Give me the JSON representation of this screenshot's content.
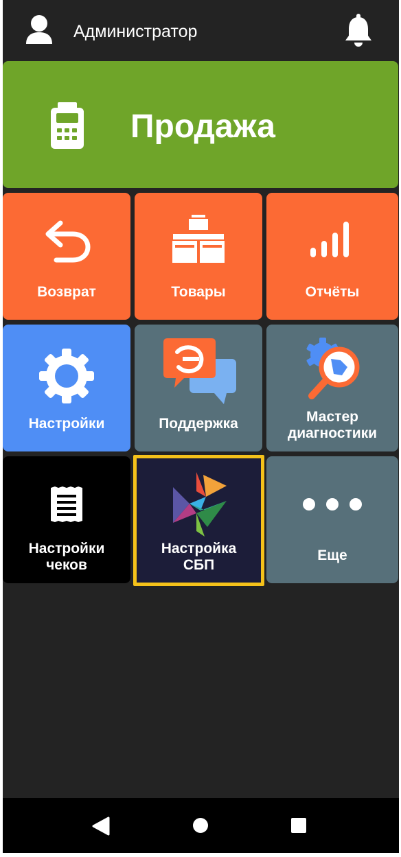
{
  "header": {
    "user_name": "Администратор"
  },
  "tiles": {
    "sale": "Продажа",
    "refund": "Возврат",
    "goods": "Товары",
    "reports": "Отчёты",
    "settings": "Настройки",
    "support": "Поддержка",
    "diagnostics_line1": "Мастер",
    "diagnostics_line2": "диагностики",
    "receipt_settings_line1": "Настройки",
    "receipt_settings_line2": "чеков",
    "sbp_line1": "Настройка",
    "sbp_line2": "СБП",
    "more": "Еще"
  },
  "icons": {
    "user": "user-icon",
    "bell": "bell-icon",
    "terminal": "payment-terminal-icon",
    "undo": "undo-arrow-icon",
    "boxes": "boxes-icon",
    "signal": "bar-chart-icon",
    "gear": "gear-icon",
    "support": "chat-bubbles-icon",
    "diagnostics": "magnifier-gear-icon",
    "receipt": "receipt-icon",
    "sbp": "sbp-logo-icon",
    "more": "dots-icon",
    "back": "back-triangle-icon",
    "home": "home-circle-icon",
    "recents": "recents-square-icon"
  },
  "colors": {
    "sale": "#6fa529",
    "orange": "#fc6a34",
    "blue": "#4f8ef5",
    "slate": "#57707a",
    "navy": "#1c1d39",
    "highlight": "#f5c21a"
  }
}
